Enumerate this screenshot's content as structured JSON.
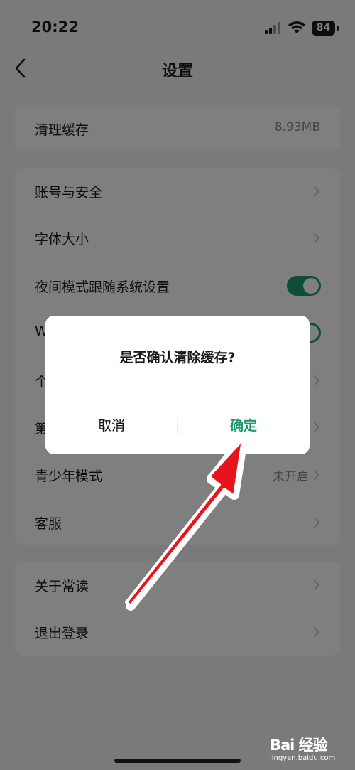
{
  "status_bar": {
    "time": "20:22",
    "battery": "84"
  },
  "nav": {
    "title": "设置"
  },
  "cache_row": {
    "label": "清理缓存",
    "value": "8.93MB"
  },
  "settings": [
    {
      "label": "账号与安全",
      "type": "chevron"
    },
    {
      "label": "字体大小",
      "type": "chevron"
    },
    {
      "label": "夜间模式跟随系统设置",
      "type": "toggle",
      "on": true
    },
    {
      "label": "W",
      "type": "toggle",
      "on": true
    },
    {
      "label": "个",
      "type": "chevron"
    },
    {
      "label": "第",
      "type": "chevron"
    },
    {
      "label": "青少年模式",
      "type": "chevron",
      "value": "未开启"
    },
    {
      "label": "客服",
      "type": "chevron"
    }
  ],
  "about": [
    {
      "label": "关于常读"
    },
    {
      "label": "退出登录"
    }
  ],
  "dialog": {
    "message": "是否确认清除缓存?",
    "cancel": "取消",
    "confirm": "确定"
  },
  "watermark": {
    "logo": "Bai 经验",
    "sub": "jingyan.baidu.com"
  },
  "colors": {
    "accent": "#1d9a6c",
    "annotation": "#e8141b"
  },
  "icons": [
    "back-icon",
    "chevron-right-icon",
    "signal-icon",
    "wifi-icon",
    "battery-icon",
    "arrow-annotation"
  ]
}
